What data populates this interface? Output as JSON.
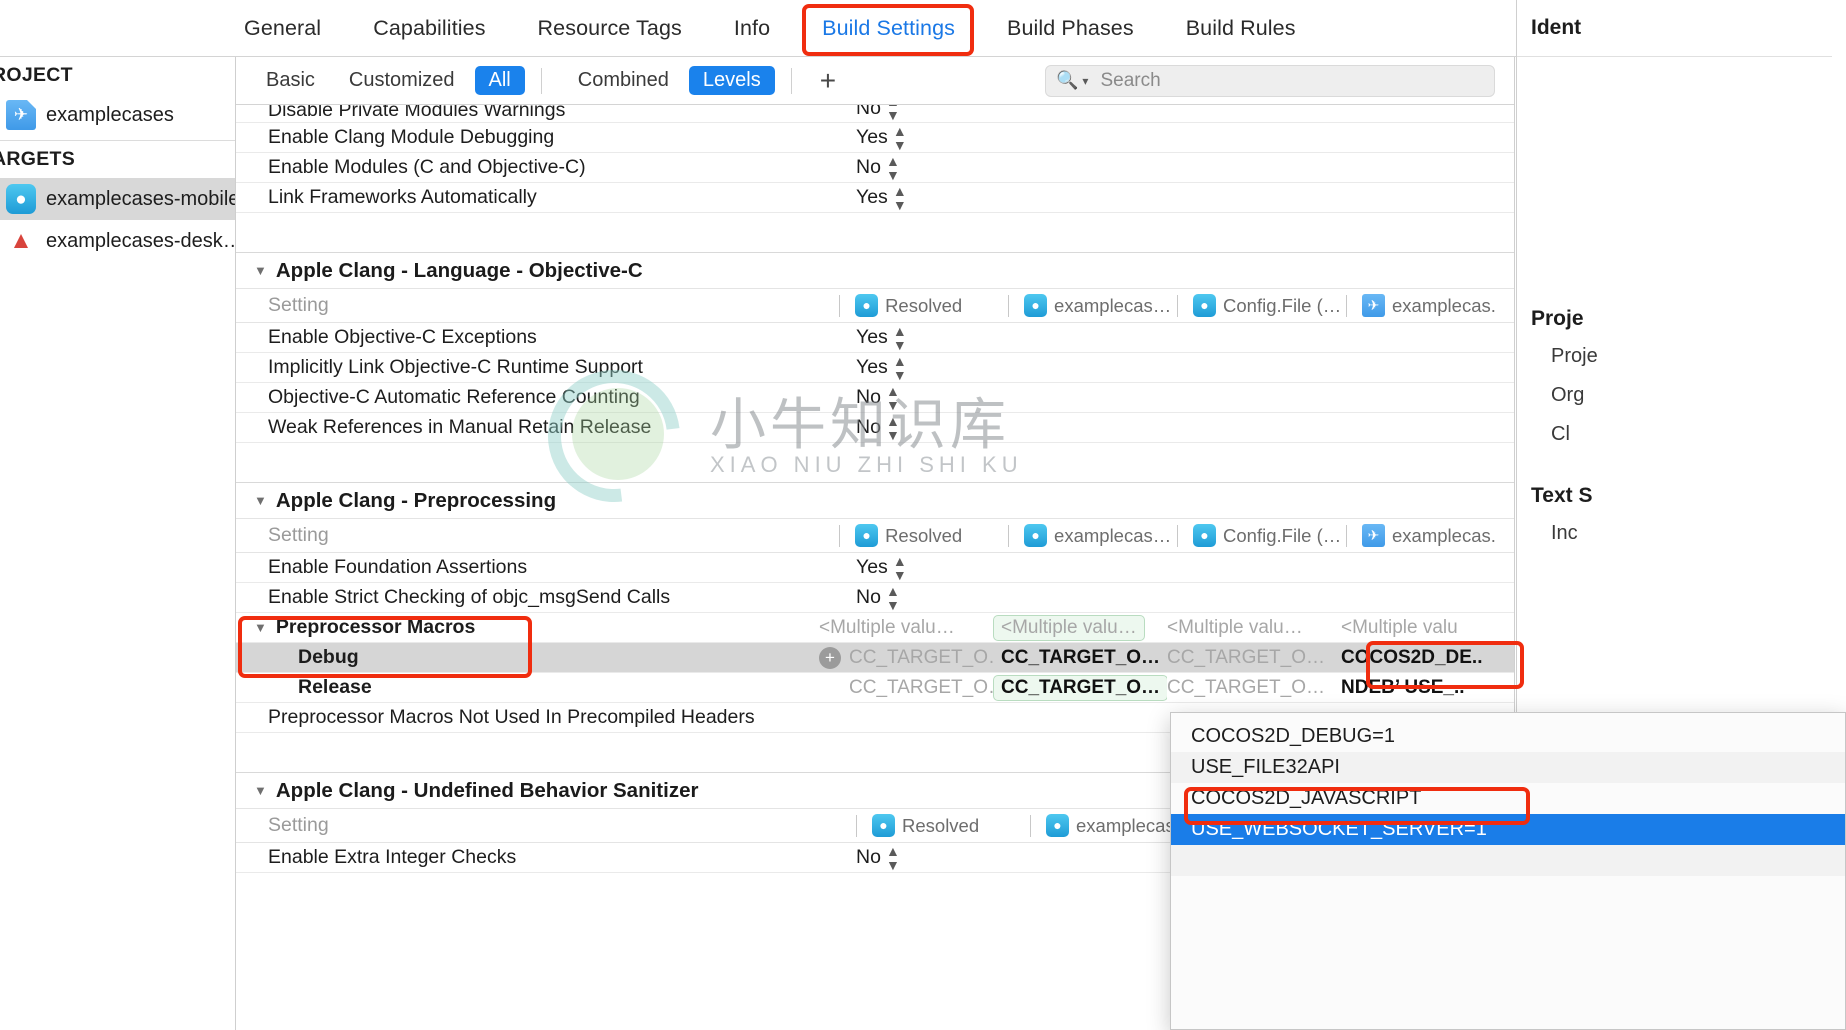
{
  "tabs": [
    {
      "label": "General",
      "active": false
    },
    {
      "label": "Capabilities",
      "active": false
    },
    {
      "label": "Resource Tags",
      "active": false
    },
    {
      "label": "Info",
      "active": false
    },
    {
      "label": "Build Settings",
      "active": true
    },
    {
      "label": "Build Phases",
      "active": false
    },
    {
      "label": "Build Rules",
      "active": false
    }
  ],
  "sidebar": {
    "project_group": "ROJECT",
    "targets_group": "ARGETS",
    "project_items": [
      {
        "label": "examplecases",
        "icon": "project-document-icon",
        "glyph": "✈"
      }
    ],
    "target_items": [
      {
        "label": "examplecases-mobile",
        "icon": "cocos-droplet-icon",
        "glyph": "●",
        "selected": true
      },
      {
        "label": "examplecases-desk…",
        "icon": "desktop-app-icon",
        "glyph": "▲",
        "selected": false
      }
    ]
  },
  "filterbar": {
    "segments_scope": [
      {
        "label": "Basic",
        "on": false
      },
      {
        "label": "Customized",
        "on": false
      },
      {
        "label": "All",
        "on": true
      }
    ],
    "segments_mode": [
      {
        "label": "Combined",
        "on": false
      },
      {
        "label": "Levels",
        "on": true
      }
    ],
    "add_label": "+",
    "search_placeholder": "Search",
    "search_value": "",
    "search_icon": "magnifier-icon",
    "chevron_icon": "chevron-down-icon"
  },
  "columns": {
    "setting_label": "Setting",
    "cells": [
      {
        "label": "Resolved",
        "icon": "cocos-droplet-icon"
      },
      {
        "label": "examplecas…",
        "icon": "cocos-droplet-icon"
      },
      {
        "label": "Config.File (…",
        "icon": "cocos-droplet-icon"
      },
      {
        "label": "examplecas.",
        "icon": "project-document-icon"
      }
    ]
  },
  "table": {
    "partial_top_row": {
      "name": "Disable Private Modules Warnings",
      "value": "No"
    },
    "modules_rows": [
      {
        "name": "Enable Clang Module Debugging",
        "value": "Yes"
      },
      {
        "name": "Enable Modules (C and Objective-C)",
        "value": "No"
      },
      {
        "name": "Link Frameworks Automatically",
        "value": "Yes"
      }
    ],
    "section_objc": {
      "title": "Apple Clang - Language - Objective-C",
      "rows": [
        {
          "name": "Enable Objective-C Exceptions",
          "value": "Yes"
        },
        {
          "name": "Implicitly Link Objective-C Runtime Support",
          "value": "Yes"
        },
        {
          "name": "Objective-C Automatic Reference Counting",
          "value": "No"
        },
        {
          "name": "Weak References in Manual Retain Release",
          "value": "No"
        }
      ]
    },
    "section_preproc": {
      "title": "Apple Clang - Preprocessing",
      "rows": [
        {
          "name": "Enable Foundation Assertions",
          "value": "Yes"
        },
        {
          "name": "Enable Strict Checking of objc_msgSend Calls",
          "value": "No"
        }
      ],
      "macros_title": "Preprocessor Macros",
      "macros_header_cells": [
        "<Multiple valu…",
        "<Multiple valu…",
        "<Multiple valu…",
        "<Multiple valu"
      ],
      "debug_label": "Debug",
      "debug_cells": [
        "CC_TARGET_O…",
        "CC_TARGET_O…",
        "CC_TARGET_O…",
        "COCOS2D_DE.."
      ],
      "release_label": "Release",
      "release_cells": [
        "CC_TARGET_O…",
        "CC_TARGET_O…",
        "CC_TARGET_O…",
        "NDEB’   USE_.."
      ],
      "not_used_row": "Preprocessor Macros Not Used In Precompiled Headers"
    },
    "section_ubsan": {
      "title": "Apple Clang - Undefined Behavior Sanitizer",
      "rows": [
        {
          "name": "Enable Extra Integer Checks",
          "value": "No"
        }
      ]
    }
  },
  "popup": {
    "items": [
      {
        "label": "COCOS2D_DEBUG=1",
        "selected": false
      },
      {
        "label": "USE_FILE32API",
        "selected": false
      },
      {
        "label": "COCOS2D_JAVASCRIPT",
        "selected": false
      },
      {
        "label": "USE_WEBSOCKET_SERVER=1",
        "selected": true
      }
    ]
  },
  "inspector": {
    "title": "Ident",
    "project_head": "Proje",
    "project_fields": [
      "Proje",
      "Org",
      "Cl"
    ],
    "text_head": "Text S",
    "text_fields": [
      "Inc"
    ]
  },
  "watermark": {
    "cn": "小牛知识库",
    "en": "XIAO NIU ZHI SHI KU"
  },
  "colors": {
    "accent_blue": "#1a82ec",
    "annotation_red": "#f02d0f",
    "selection_blue": "#1a7de8",
    "row_selected_gray": "#d6d6d6"
  }
}
